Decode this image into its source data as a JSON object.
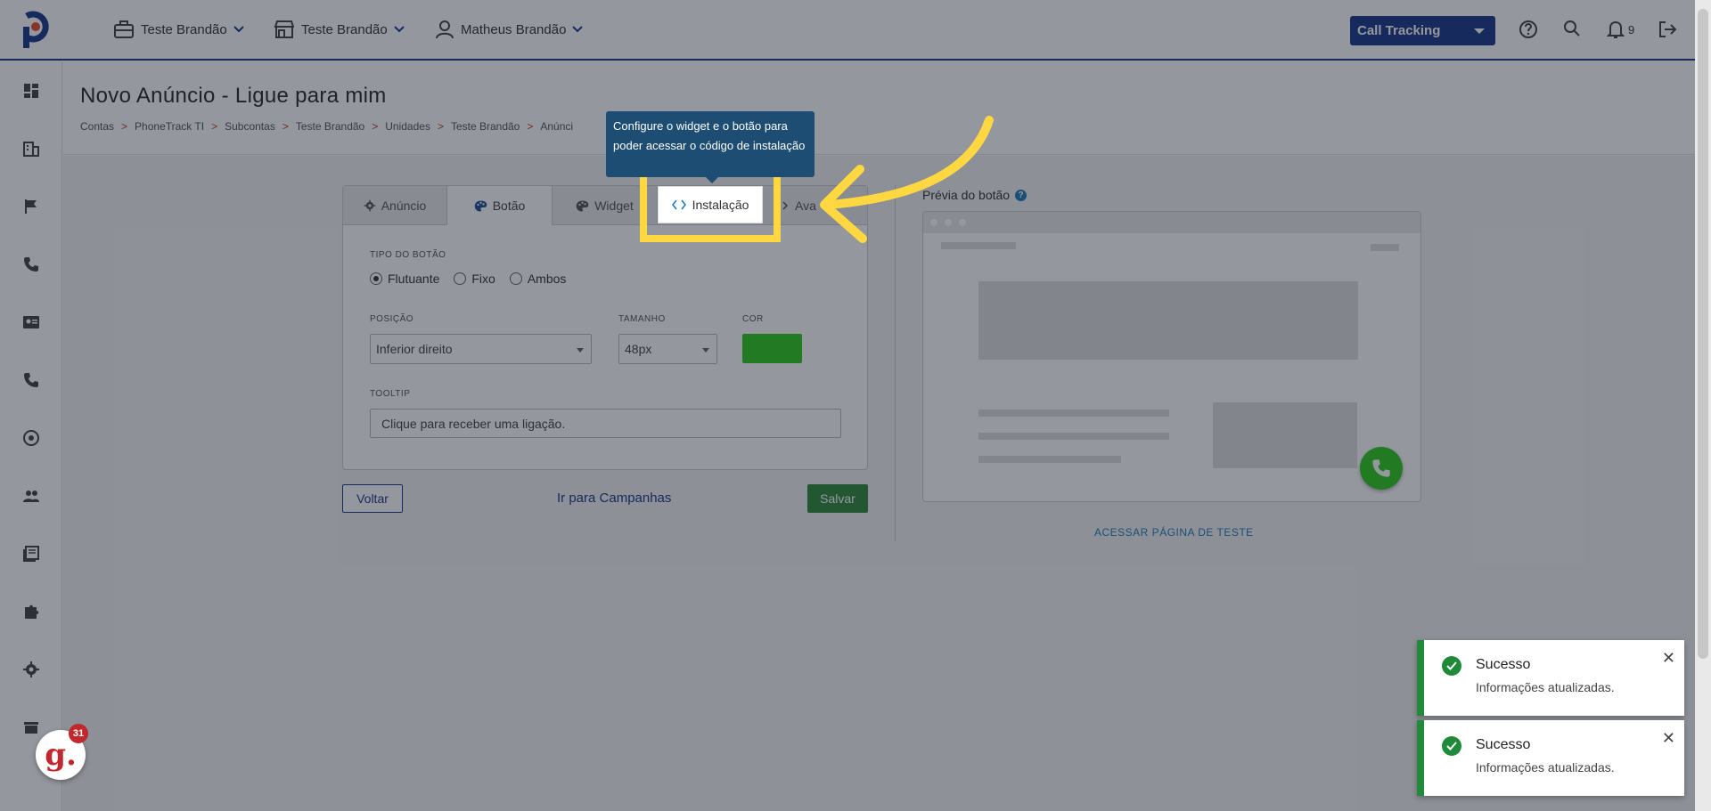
{
  "topbar": {
    "account": "Teste Brandão",
    "unit": "Teste Brandão",
    "user": "Matheus Brandão",
    "product_select": "Call Tracking",
    "notifications_count": "9"
  },
  "page": {
    "title": "Novo Anúncio - Ligue para mim",
    "breadcrumb": [
      "Contas",
      "PhoneTrack TI",
      "Subcontas",
      "Teste Brandão",
      "Unidades",
      "Teste Brandão",
      "Anúnci"
    ]
  },
  "tabs": [
    {
      "label": "Anúncio"
    },
    {
      "label": "Botão"
    },
    {
      "label": "Widget"
    },
    {
      "label": "Instalação"
    },
    {
      "label": "Ava"
    }
  ],
  "form": {
    "button_type_label": "TIPO DO BOTÃO",
    "button_types": [
      "Flutuante",
      "Fixo",
      "Ambos"
    ],
    "selected_type": "Flutuante",
    "position_label": "POSIÇÃO",
    "position_value": "Inferior direito",
    "size_label": "TAMANHO",
    "size_value": "48px",
    "color_label": "COR",
    "color_value": "#2ecc1f",
    "tooltip_label": "TOOLTIP",
    "tooltip_value": "Clique para receber uma ligação."
  },
  "actions": {
    "back": "Voltar",
    "campaigns": "Ir para Campanhas",
    "save": "Salvar"
  },
  "preview": {
    "label": "Prévia do botão",
    "test_link": "ACESSAR PÁGINA DE TESTE"
  },
  "guide_tooltip": {
    "text": "Configure o widget e o botão para poder acessar o código de instalação"
  },
  "toasts": [
    {
      "title": "Sucesso",
      "message": "Informações atualizadas."
    },
    {
      "title": "Sucesso",
      "message": "Informações atualizadas."
    }
  ],
  "chat_badge": {
    "letter": "g.",
    "count": "31"
  }
}
